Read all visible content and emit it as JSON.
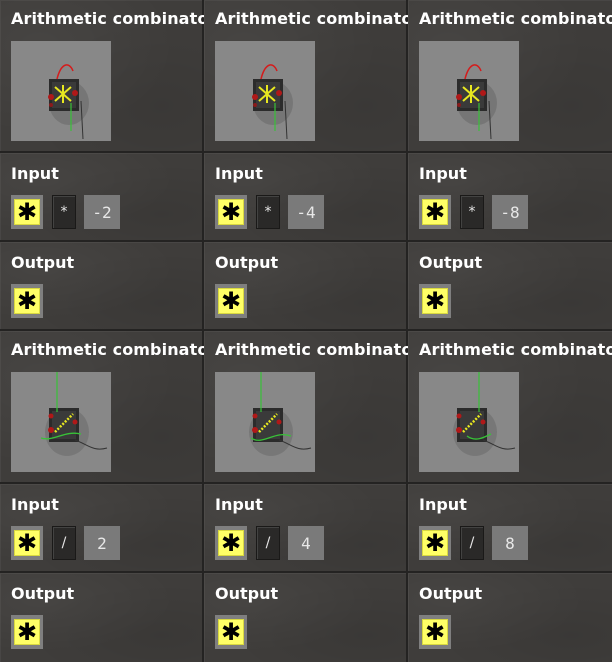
{
  "colors": {
    "signal_yellow": "#ffff66",
    "panel_bg": "#3f3d3b",
    "preview_bg": "#888888"
  },
  "blocks": [
    {
      "title": "Arithmetic combinator",
      "input_label": "Input",
      "signal_icon": "signal-everything-icon",
      "signal_glyph": "✱",
      "operator": "*",
      "constant": "-2",
      "output_label": "Output"
    },
    {
      "title": "Arithmetic combinator",
      "input_label": "Input",
      "signal_icon": "signal-everything-icon",
      "signal_glyph": "✱",
      "operator": "*",
      "constant": "-4",
      "output_label": "Output"
    },
    {
      "title": "Arithmetic combinator",
      "input_label": "Input",
      "signal_icon": "signal-everything-icon",
      "signal_glyph": "✱",
      "operator": "*",
      "constant": "-8",
      "output_label": "Output"
    },
    {
      "title": "Arithmetic combinator",
      "input_label": "Input",
      "signal_icon": "signal-everything-icon",
      "signal_glyph": "✱",
      "operator": "/",
      "constant": "2",
      "output_label": "Output"
    },
    {
      "title": "Arithmetic combinator",
      "input_label": "Input",
      "signal_icon": "signal-everything-icon",
      "signal_glyph": "✱",
      "operator": "/",
      "constant": "4",
      "output_label": "Output"
    },
    {
      "title": "Arithmetic combinator",
      "input_label": "Input",
      "signal_icon": "signal-everything-icon",
      "signal_glyph": "✱",
      "operator": "/",
      "constant": "8",
      "output_label": "Output"
    }
  ]
}
